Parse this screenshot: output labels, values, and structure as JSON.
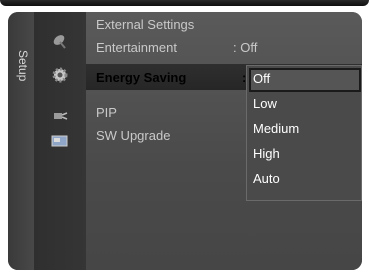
{
  "sidebar": {
    "tab_label": "Setup"
  },
  "menu": {
    "items": [
      {
        "label": "External Settings",
        "value": ""
      },
      {
        "label": "Entertainment",
        "value": ": Off"
      },
      {
        "label": "Energy Saving",
        "value": ":"
      },
      {
        "label": "PIP",
        "value": ""
      },
      {
        "label": "SW Upgrade",
        "value": ""
      }
    ],
    "selected_index": 2
  },
  "dropdown": {
    "options": [
      "Off",
      "Low",
      "Medium",
      "High",
      "Auto"
    ],
    "selected": "Off"
  },
  "icons": [
    "satellite-dish-icon",
    "settings-gear-icon",
    "plug-icon",
    "input-source-icon"
  ]
}
